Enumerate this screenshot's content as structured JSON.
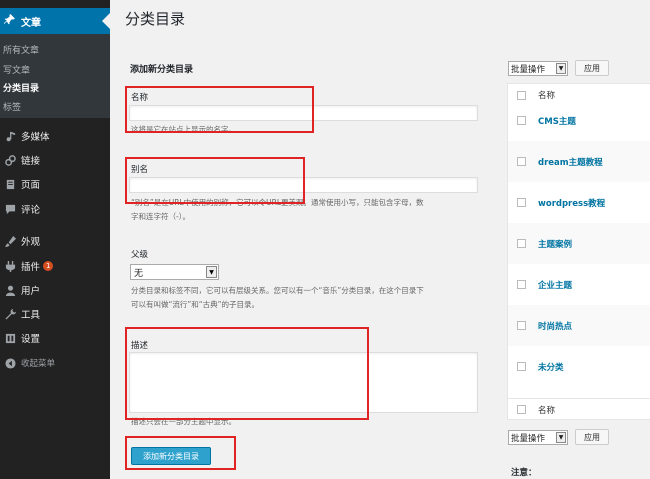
{
  "sidebar": {
    "active_label": "文章",
    "sub_items": [
      "所有文章",
      "写文章",
      "分类目录",
      "标签"
    ],
    "items": [
      {
        "label": "多媒体",
        "icon": "media-icon"
      },
      {
        "label": "链接",
        "icon": "link-icon"
      },
      {
        "label": "页面",
        "icon": "page-icon"
      },
      {
        "label": "评论",
        "icon": "comment-icon"
      },
      {
        "label": "外观",
        "icon": "appearance-icon"
      },
      {
        "label": "插件",
        "icon": "plugin-icon",
        "badge": "1"
      },
      {
        "label": "用户",
        "icon": "user-icon"
      },
      {
        "label": "工具",
        "icon": "tools-icon"
      },
      {
        "label": "设置",
        "icon": "settings-icon"
      },
      {
        "label": "收起菜单",
        "icon": "collapse-icon"
      }
    ]
  },
  "page": {
    "title": "分类目录"
  },
  "form": {
    "title": "添加新分类目录",
    "name_label": "名称",
    "name_value": "",
    "name_desc": "这将是它在站点上显示的名字。",
    "slug_label": "别名",
    "slug_value": "",
    "slug_desc_1": "“别名”是在URL中使用的别称，它可以令URL更美观。通常使用小写，只能包含字母，数",
    "slug_desc_2": "字和连字符（-）。",
    "parent_label": "父级",
    "parent_value": "无",
    "parent_desc_1": "分类目录和标签不同，它可以有层级关系。您可以有一个“音乐”分类目录，在这个目录下",
    "parent_desc_2": "可以有叫做“流行”和“古典”的子目录。",
    "description_label": "描述",
    "description_value": "",
    "description_desc": "描述只会在一部分主题中显示。",
    "submit_label": "添加新分类目录"
  },
  "list": {
    "bulk_action_label": "批量操作",
    "apply_label": "应用",
    "column_name": "名称",
    "rows": [
      "CMS主题",
      "dream主题教程",
      "wordpress教程",
      "主题案例",
      "企业主题",
      "时尚热点",
      "未分类"
    ],
    "note_label": "注意："
  },
  "colors": {
    "sidebar_bg": "#222222",
    "active_menu": "#0073aa",
    "primary_button": "#2ea2cc",
    "link": "#0074a2",
    "highlight_box": "#e02424"
  }
}
